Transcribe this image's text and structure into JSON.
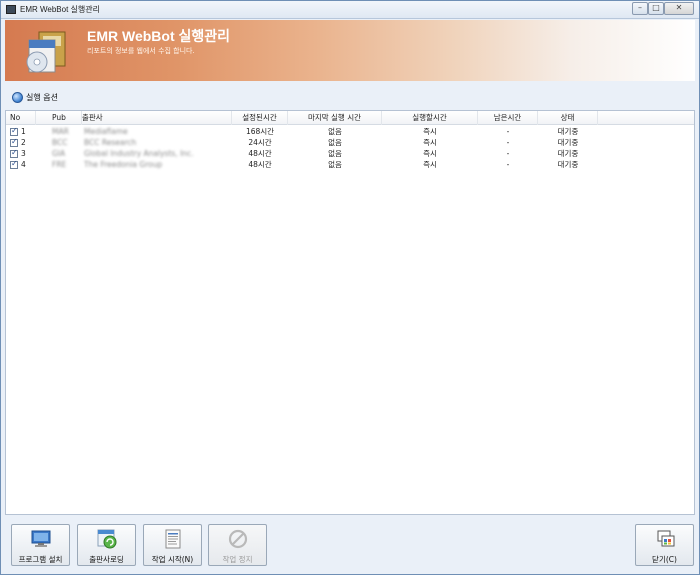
{
  "window": {
    "title": "EMR WebBot 실행관리"
  },
  "banner": {
    "title": "EMR WebBot 실행관리",
    "subtitle": "리포트의 정보를 웹에서 수집 합니다."
  },
  "toolbar": {
    "run_options": "실행 옵션"
  },
  "table": {
    "headers": {
      "no": "No",
      "pub": "Pub",
      "publisher": "출판사",
      "interval": "설정된시간",
      "last_run": "마지막 실행 시간",
      "run_time": "실행할시간",
      "remaining": "남은시간",
      "status": "상태"
    },
    "rows": [
      {
        "no": "1",
        "checked": true,
        "pub": "MAR",
        "publisher": "Mediaflame",
        "interval": "168시간",
        "last_run": "없음",
        "run_time": "즉시",
        "remaining": "-",
        "status": "대기중"
      },
      {
        "no": "2",
        "checked": true,
        "pub": "BCC",
        "publisher": "BCC Research",
        "interval": "24시간",
        "last_run": "없음",
        "run_time": "즉시",
        "remaining": "-",
        "status": "대기중"
      },
      {
        "no": "3",
        "checked": true,
        "pub": "GIA",
        "publisher": "Global Industry Analysts, Inc.",
        "interval": "48시간",
        "last_run": "없음",
        "run_time": "즉시",
        "remaining": "-",
        "status": "대기중"
      },
      {
        "no": "4",
        "checked": true,
        "pub": "FRE",
        "publisher": "The Freedonia Group",
        "interval": "48시간",
        "last_run": "없음",
        "run_time": "즉시",
        "remaining": "-",
        "status": "대기중"
      }
    ]
  },
  "buttons": {
    "install": "프로그램 설치",
    "load_publishers": "출판사로딩",
    "start_job": "작업 시작(N)",
    "stop_job": "작업 정지",
    "close": "닫기(C)"
  },
  "icons": [
    "app-icon",
    "software-box-icon",
    "info-icon",
    "monitor-icon",
    "refresh-icon",
    "document-icon",
    "stop-icon",
    "windows-icon"
  ]
}
